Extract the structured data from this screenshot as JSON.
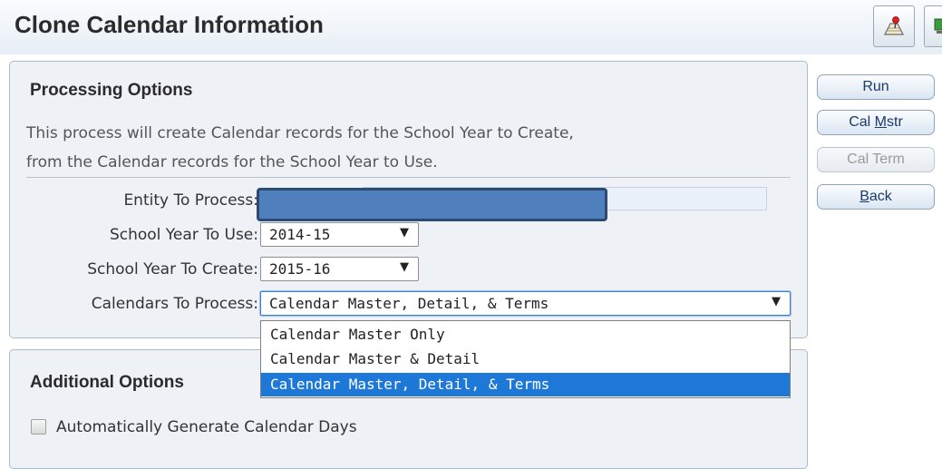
{
  "page": {
    "title": "Clone Calendar Information"
  },
  "toolbar": {
    "icons": [
      "map-pin-icon",
      "monitor-icon"
    ]
  },
  "processing": {
    "title": "Processing Options",
    "description_line1": "This process will create Calendar records for the School Year to Create,",
    "description_line2": "from the Calendar records for the School Year to Use.",
    "entity_label": "Entity To Process:",
    "year_use_label": "School Year To Use:",
    "year_use_value": "2014-15",
    "year_create_label": "School Year To Create:",
    "year_create_value": "2015-16",
    "calendars_label": "Calendars To Process:",
    "calendars_value": "Calendar Master, Detail, & Terms",
    "calendars_options": [
      "Calendar Master Only",
      "Calendar Master & Detail",
      "Calendar Master, Detail, & Terms"
    ]
  },
  "additional": {
    "title": "Additional Options",
    "auto_generate_label": "Automatically Generate Calendar Days"
  },
  "buttons": {
    "run": "Run",
    "cal_mstr_prefix": "Cal ",
    "cal_mstr_accel": "M",
    "cal_mstr_suffix": "str",
    "cal_term": "Cal Term",
    "back_accel": "B",
    "back_suffix": "ack"
  },
  "colors": {
    "accent": "#1e78d7",
    "panel_bg": "#eef1f5",
    "redaction": "#4f7fbc"
  }
}
